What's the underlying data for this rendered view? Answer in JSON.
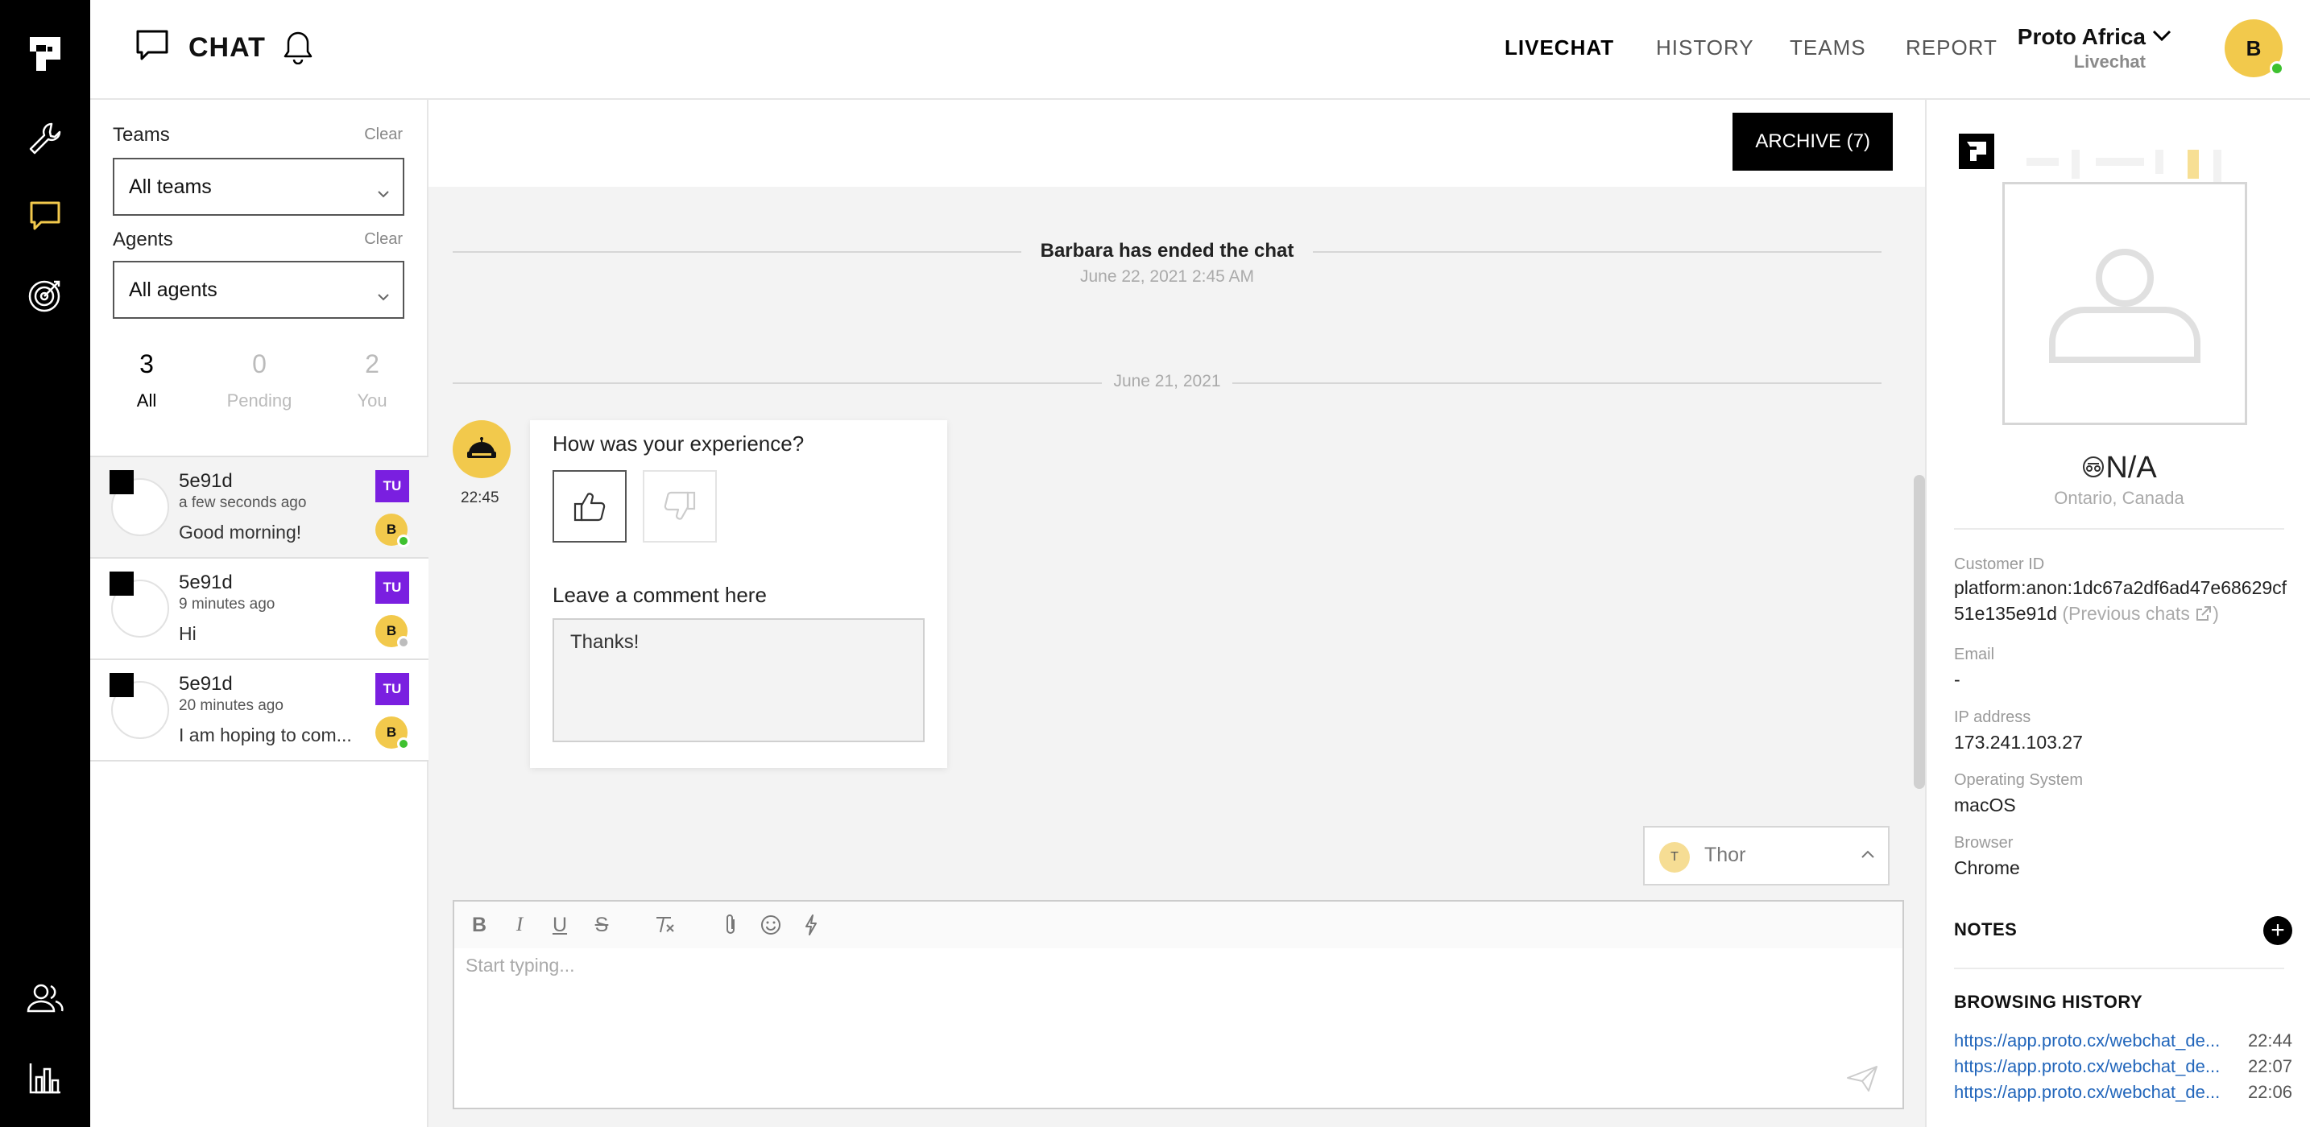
{
  "header": {
    "title": "CHAT",
    "nav": [
      "LIVECHAT",
      "HISTORY",
      "TEAMS",
      "REPORT"
    ],
    "active_nav": "LIVECHAT",
    "org_name": "Proto Africa",
    "org_sub": "Livechat",
    "user_initial": "B"
  },
  "filters": {
    "teams_label": "Teams",
    "teams_clear": "Clear",
    "teams_value": "All teams",
    "agents_label": "Agents",
    "agents_clear": "Clear",
    "agents_value": "All agents"
  },
  "tabs": [
    {
      "count": "3",
      "label": "All"
    },
    {
      "count": "0",
      "label": "Pending"
    },
    {
      "count": "2",
      "label": "You"
    }
  ],
  "conversations": [
    {
      "name": "5e91d",
      "time": "a few seconds ago",
      "message": "Good morning!",
      "team": "TU",
      "agent": "B",
      "status": "online"
    },
    {
      "name": "5e91d",
      "time": "9 minutes ago",
      "message": "Hi",
      "team": "TU",
      "agent": "B",
      "status": "offline"
    },
    {
      "name": "5e91d",
      "time": "20 minutes ago",
      "message": "I am hoping to com...",
      "team": "TU",
      "agent": "B",
      "status": "online"
    }
  ],
  "chat": {
    "archive_label": "ARCHIVE (7)",
    "ended_text": "Barbara has ended the chat",
    "ended_date": "June 22, 2021 2:45 AM",
    "date_separator": "June 21, 2021",
    "bot_time": "22:45",
    "survey_question": "How was your experience?",
    "comment_label": "Leave a comment here",
    "comment_value": "Thanks!",
    "assignee_initial": "T",
    "assignee_name": "Thor",
    "composer_placeholder": "Start typing..."
  },
  "customer": {
    "name": "N/A",
    "location": "Ontario, Canada",
    "customer_id_label": "Customer ID",
    "customer_id_line1": "platform:anon:1dc67a2df6ad47e68629cf",
    "customer_id_line2": "51e135e91d",
    "previous_chats": "(Previous chats",
    "email_label": "Email",
    "email": "-",
    "ip_label": "IP address",
    "ip": "173.241.103.27",
    "os_label": "Operating System",
    "os": "macOS",
    "browser_label": "Browser",
    "browser": "Chrome",
    "notes_label": "NOTES",
    "browsing_label": "BROWSING HISTORY",
    "browsing": [
      {
        "url": "https://app.proto.cx/webchat_de...",
        "time": "22:44"
      },
      {
        "url": "https://app.proto.cx/webchat_de...",
        "time": "22:07"
      },
      {
        "url": "https://app.proto.cx/webchat_de...",
        "time": "22:06"
      }
    ]
  },
  "colors": {
    "accent": "#F2C94C",
    "team_badge": "#7A1FE0",
    "online": "#3EC12F",
    "link": "#2266BB"
  }
}
